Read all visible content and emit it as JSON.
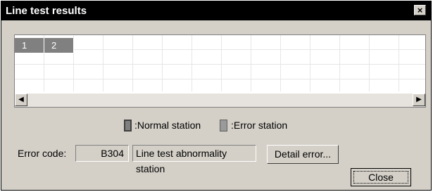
{
  "window": {
    "title": "Line test results",
    "close_glyph": "×"
  },
  "stations": [
    "1",
    "2"
  ],
  "legend": {
    "normal_label": ":Normal station",
    "error_label": ":Error station"
  },
  "error": {
    "label": "Error code:",
    "code": "B304",
    "message": "Line test abnormality station"
  },
  "buttons": {
    "detail": "Detail error...",
    "close": "Close"
  },
  "scroll": {
    "left_icon": "◀",
    "right_icon": "▶"
  }
}
